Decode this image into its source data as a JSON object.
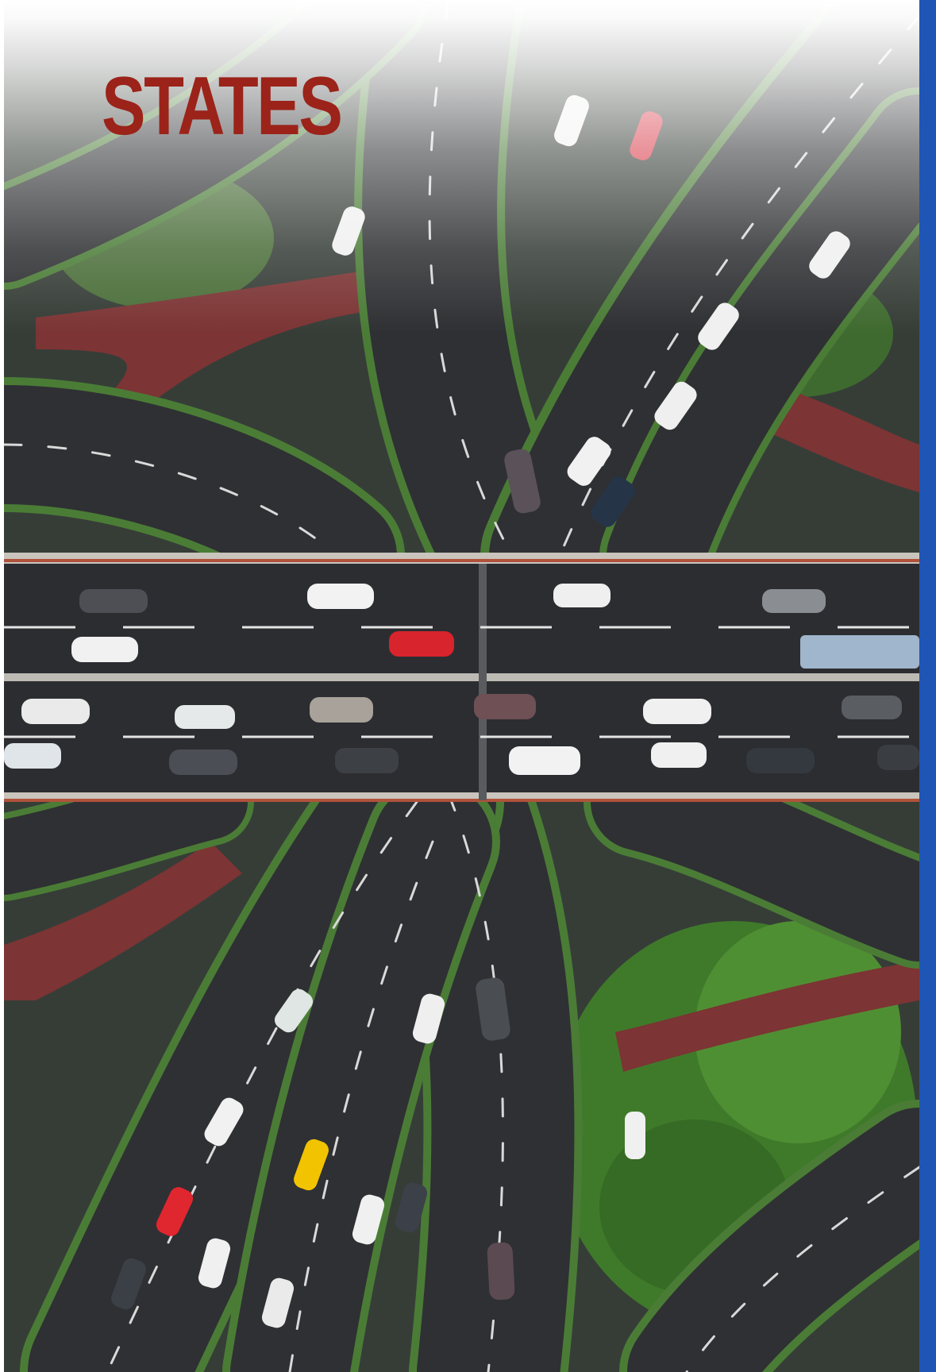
{
  "page": {
    "title": "STATES",
    "title_color": "#9b2319",
    "accent_band_color": "#1f55b5"
  },
  "image": {
    "subject": "aerial-highway-interchange"
  }
}
